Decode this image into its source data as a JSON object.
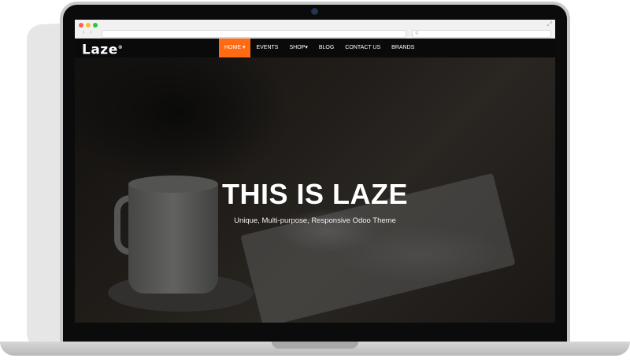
{
  "browser": {
    "back_arrow": "‹",
    "forward_arrow": "›",
    "url": "",
    "search_icon": "search-icon"
  },
  "site": {
    "logo": "Laze",
    "logo_mark": "®"
  },
  "nav": {
    "items": [
      {
        "label": "HOME ▾",
        "active": true
      },
      {
        "label": "EVENTS"
      },
      {
        "label": "SHOP▾"
      },
      {
        "label": "BLOG"
      },
      {
        "label": "CONTACT US"
      },
      {
        "label": "BRANDS"
      }
    ]
  },
  "hero": {
    "title": "THIS IS LAZE",
    "subtitle": "Unique, Multi-purpose, Responsive Odoo Theme"
  },
  "colors": {
    "accent": "#ff6a13",
    "nav_bg": "#0a0a0a"
  }
}
